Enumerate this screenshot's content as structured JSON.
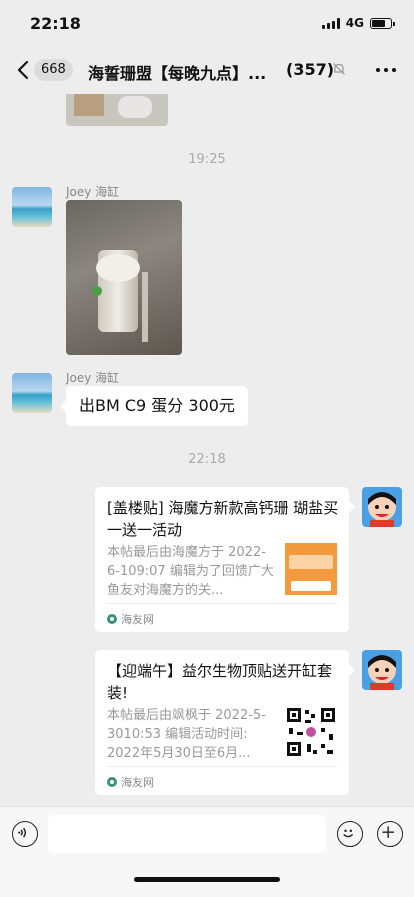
{
  "status": {
    "time": "22:18",
    "network": "4G",
    "battery_level": 0.7
  },
  "nav": {
    "unread": "668",
    "title": "海誓珊盟【每晚九点】...",
    "member_count": "(357)"
  },
  "messages": {
    "ts1": "19:25",
    "sender1": "Joey 海缸",
    "sender2": "Joey 海缸",
    "text2": "出BM C9 蛋分 300元",
    "ts2": "22:18"
  },
  "cards": [
    {
      "title": "[盖楼贴] 海魔方新款高钙珊 瑚盐买一送一活动",
      "desc": "本帖最后由海魔方于 2022-6-109:07 编辑为了回馈广大鱼友对海魔方的关...",
      "source": "海友网",
      "image": "orange-product"
    },
    {
      "title": "【迎端午】益尔生物顶贴送开缸套装!",
      "desc": "本帖最后由飒枫于 2022-5-3010:53 编辑活动时间: 2022年5月30日至6月...",
      "source": "海友网",
      "image": "qr-code"
    }
  ],
  "input": {
    "placeholder": ""
  },
  "icons": [
    "back-chevron-icon",
    "mute-bell-icon",
    "more-dots-icon",
    "voice-icon",
    "emoji-icon",
    "plus-icon"
  ],
  "colors": {
    "background": "#ededed",
    "bubble": "#ffffff",
    "timestamp": "#aaaaaa"
  }
}
